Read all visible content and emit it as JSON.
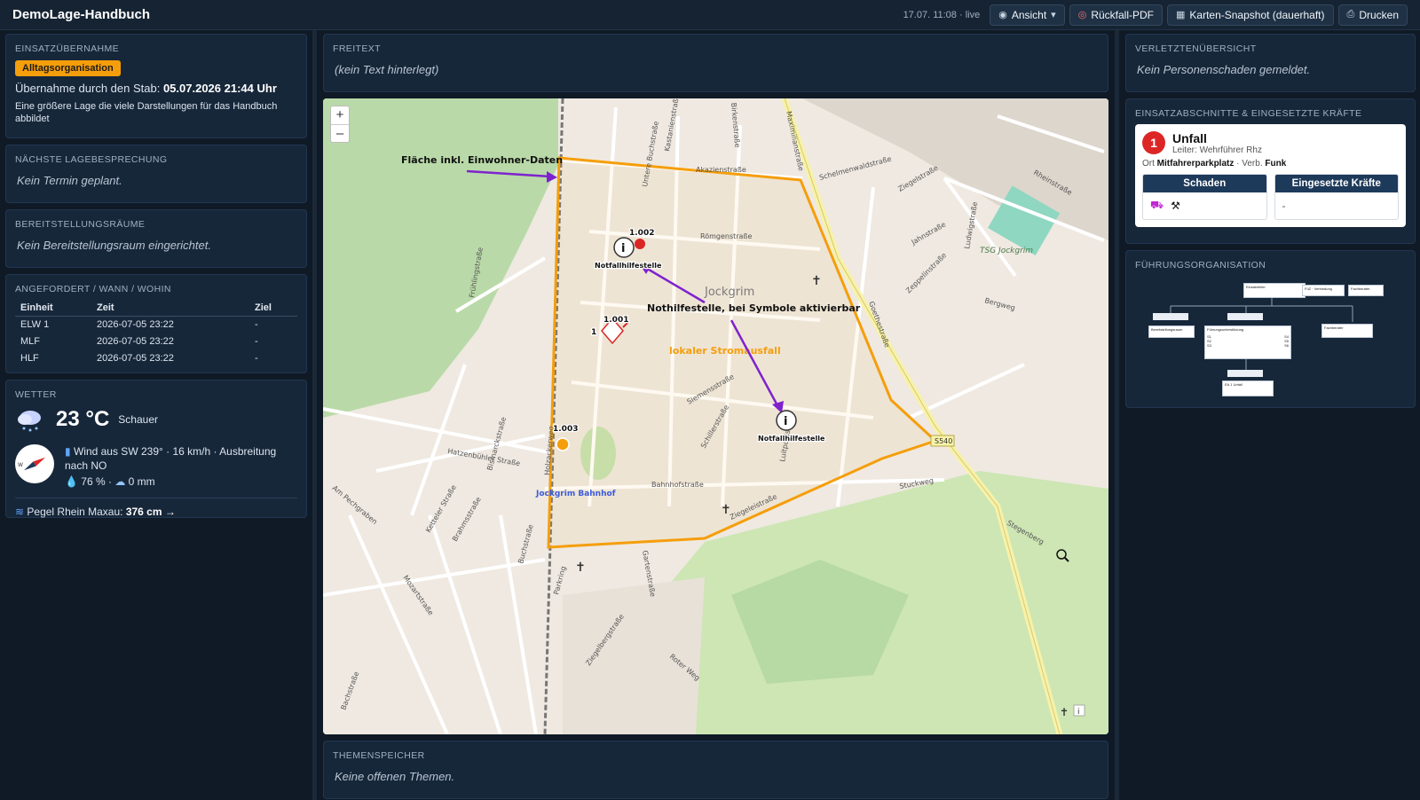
{
  "app": {
    "title": "DemoLage-Handbuch",
    "timestamp": "17.07. 11:08 · live"
  },
  "toolbar": {
    "view_label": "Ansicht",
    "fallback_pdf_label": "Rückfall-PDF",
    "snapshot_label": "Karten-Snapshot (dauerhaft)",
    "print_label": "Drucken"
  },
  "takeover": {
    "title": "EINSATZÜBERNAHME",
    "badge": "Alltagsorganisation",
    "by_staff_label": "Übernahme durch den Stab:",
    "by_staff_value": "05.07.2026 21:44 Uhr",
    "description": "Eine größere Lage die viele Darstellungen für das Handbuch abbildet"
  },
  "next_briefing": {
    "title": "NÄCHSTE LAGEBESPRECHUNG",
    "empty": "Kein Termin geplant."
  },
  "staging": {
    "title": "BEREITSTELLUNGSRÄUME",
    "empty": "Kein Bereitstellungsraum eingerichtet."
  },
  "requested": {
    "title": "ANGEFORDERT / WANN / WOHIN",
    "headers": [
      "Einheit",
      "Zeit",
      "Ziel"
    ],
    "rows": [
      [
        "ELW 1",
        "2026-07-05 23:22",
        "-"
      ],
      [
        "MLF",
        "2026-07-05 23:22",
        "-"
      ],
      [
        "HLF",
        "2026-07-05 23:22",
        "-"
      ]
    ]
  },
  "weather": {
    "title": "WETTER",
    "temperature": "23 °C",
    "condition": "Schauer",
    "wind": "Wind aus SW 239° · 16 km/h · Ausbreitung nach NO",
    "humidity": "76 %",
    "precip": "0 mm",
    "pegel_label": "Pegel Rhein Maxau:",
    "pegel_value": "376 cm →",
    "wind_direction_deg": 239
  },
  "freetext": {
    "title": "FREITEXT",
    "empty": "(kein Text hinterlegt)"
  },
  "topics": {
    "title": "THEMENSPEICHER",
    "empty": "Keine offenen Themen."
  },
  "map": {
    "zoom_in": "+",
    "zoom_out": "–",
    "annotations": {
      "area": "Fläche inkl. Einwohner-Daten",
      "emergency": "Nothilfestelle, bei Symbole aktivierbar",
      "outage": "lokaler Stromausfall"
    },
    "markers": {
      "m1002": "1.002",
      "m1001": "1.001",
      "m1003": "1.003",
      "m_one": "1",
      "nhs1": "Notfallhilfestelle",
      "nhs2": "Notfallhilfestelle"
    },
    "streets": {
      "s1": "Akazienstraße",
      "s2": "Römgenstraße",
      "s3": "Schelmenwaldstraße",
      "s4": "Ziegelstraße",
      "s5": "Rheinstraße",
      "s6": "Jahnstraße",
      "s7": "Zeppelinstraße",
      "s8": "Goethestraße",
      "s9": "Bergweg",
      "s10": "Ludwigstraße",
      "s11": "Maximilianstraße",
      "s12": "Schillerstraße",
      "s13": "Siemensstraße",
      "s14": "Bahnhofstraße",
      "s15": "Ziegeleistraße",
      "s16": "Luitpoldstraße",
      "s17": "Stuckweg",
      "s18": "Stegenberg",
      "s19": "Hatzenbühler Straße",
      "s20": "Bismarckstraße",
      "s21": "Ketteler Straße",
      "s22": "Brahmsstraße",
      "s23": "Mozartstraße",
      "s24": "Buchstraße",
      "s25": "Frühlingstraße",
      "s26": "Holzackerweg",
      "s27": "Gartenstraße",
      "s28": "Ziegelbergstraße",
      "s29": "Roter Weg",
      "s30": "Am Pechgraben",
      "s31": "Birkenstraße",
      "s32": "Kastanienstraße",
      "s33": "Untere Buchstraße",
      "s34": "Parkring",
      "s35": "Bachstraße"
    },
    "places": {
      "town": "Jockgrim",
      "station": "Jockgrim Bahnhof",
      "sport": "TSG Jockgrim",
      "road": "S540"
    }
  },
  "injured": {
    "title": "VERLETZTENÜBERSICHT",
    "empty": "Kein Personenschaden gemeldet."
  },
  "sections": {
    "title": "EINSATZABSCHNITTE & EINGESETZTE KRÄFTE",
    "number": "1",
    "name": "Unfall",
    "leader": "Leiter: Wehrführer Rhz",
    "location_label": "Ort",
    "location_value": "Mitfahrerparkplatz",
    "connection_label": "Verb.",
    "connection_value": "Funk",
    "damage_header": "Schaden",
    "forces_header": "Eingesetzte Kräfte",
    "forces_value": "-"
  },
  "leadership": {
    "title": "FÜHRUNGSORGANISATION",
    "boxes": {
      "einsatzleiter": "Einsatzleiter",
      "fuhrung": "FüZ · Verbindung",
      "fachberater": "Fachberater",
      "bereitstellung": "Bereitstellungsraum",
      "fuhrungsunterstutzung": "Führungsunterstützung",
      "s1": "S1",
      "s2": "S2",
      "s3": "S3",
      "s4": "S4",
      "s5": "S5",
      "s6": "S6",
      "ea1": "EA 1 Unfall"
    }
  }
}
